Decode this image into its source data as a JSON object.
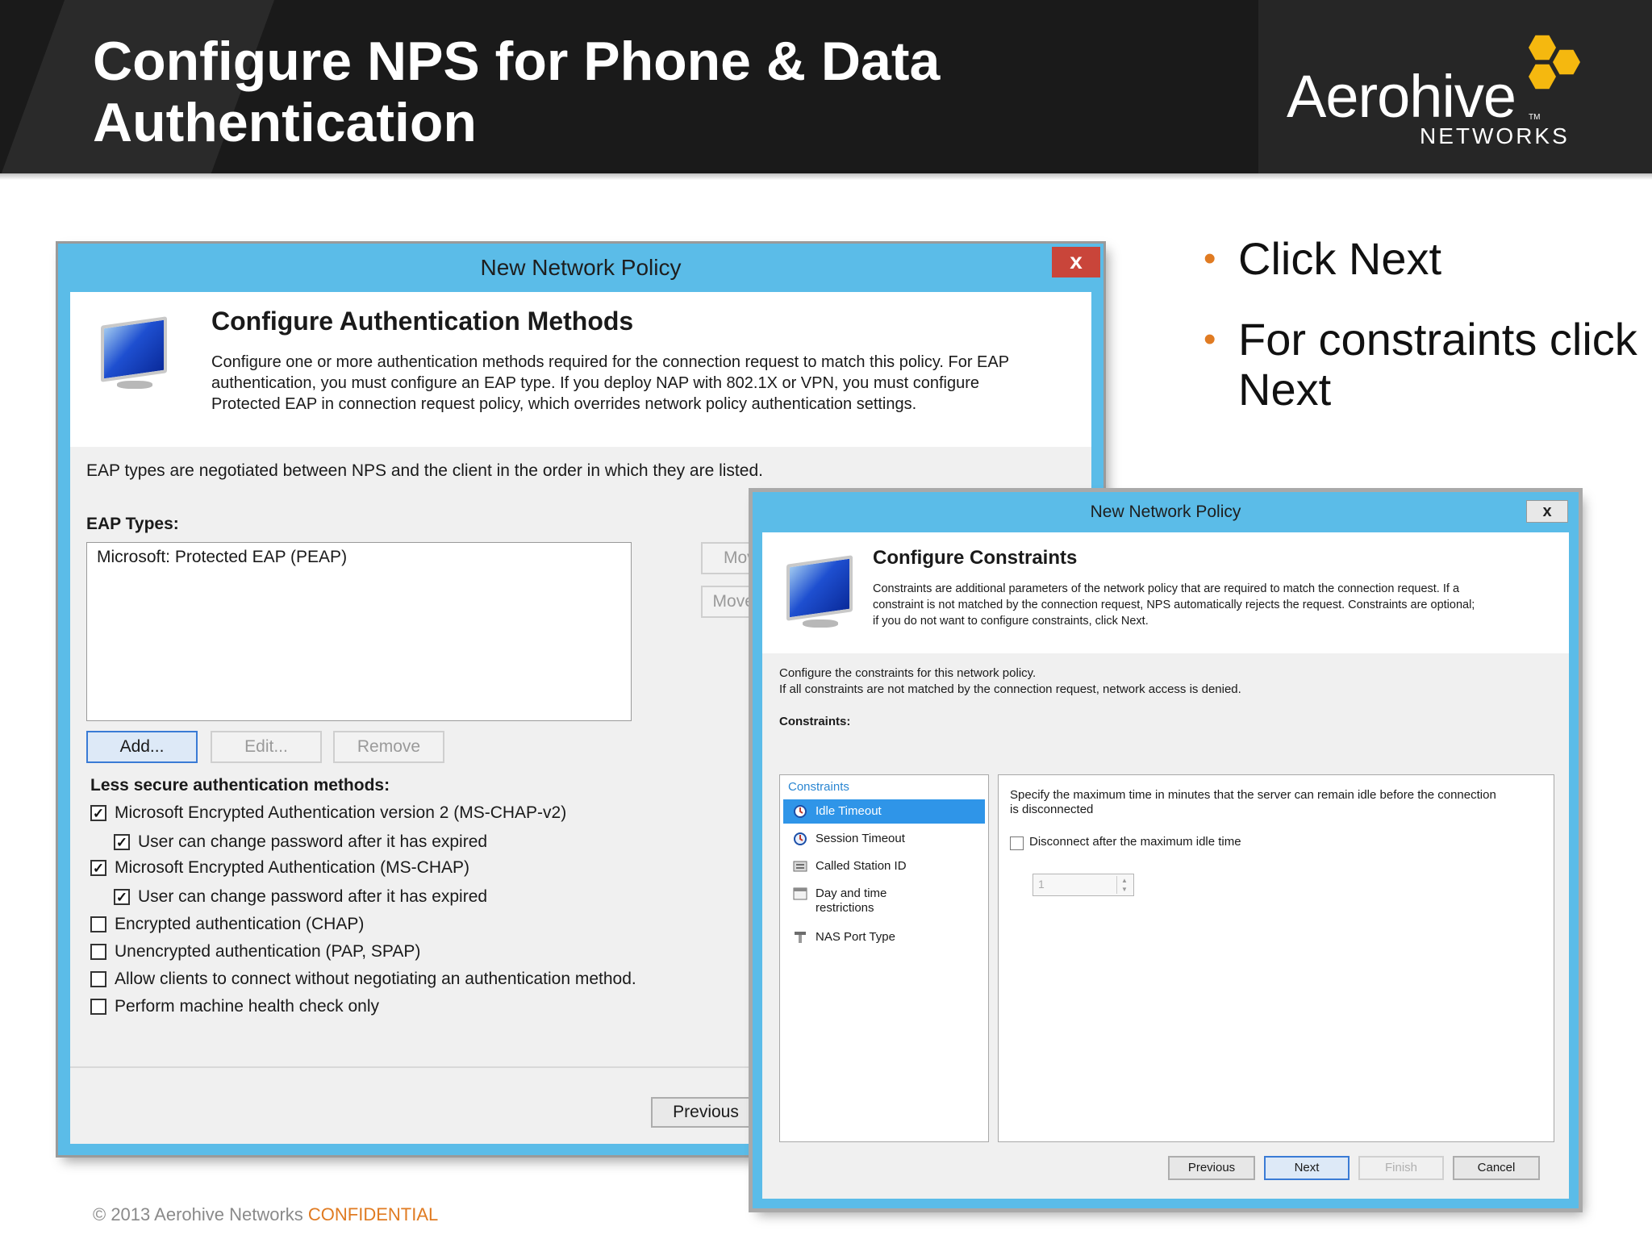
{
  "slide": {
    "title_line1": "Configure NPS for Phone & Data",
    "title_line2": "Authentication",
    "logo_word": "Aerohive",
    "logo_tm": "TM",
    "logo_sub": "NETWORKS",
    "bullets": [
      "Click Next",
      "For constraints click Next"
    ],
    "bullet_glyph": "•",
    "footer_copyright": "© 2013 Aerohive Networks ",
    "footer_confidential": "CONFIDENTIAL",
    "colors": {
      "header_bg": "#1a1a1a",
      "accent_orange": "#e07b22",
      "logo_yellow": "#f5b80f",
      "window_frame": "#5bbce8"
    }
  },
  "dialog1": {
    "title": "New Network Policy",
    "close_glyph": "x",
    "heading": "Configure Authentication Methods",
    "description": [
      "Configure one or more authentication methods required for the connection request to match this policy. For EAP",
      "authentication, you must configure an EAP type. If you deploy NAP with 802.1X or VPN, you must configure",
      "Protected EAP in connection request policy, which overrides network policy authentication settings."
    ],
    "eap_note": "EAP types are negotiated between NPS and the client in the order in which they are listed.",
    "eap_types_label": "EAP Types:",
    "eap_list": [
      "Microsoft: Protected EAP (PEAP)"
    ],
    "move_up_label": "Move Up",
    "move_down_label": "Move Down",
    "add_label": "Add...",
    "edit_label": "Edit...",
    "remove_label": "Remove",
    "less_secure_label": "Less secure authentication methods:",
    "methods": [
      {
        "label": "Microsoft Encrypted Authentication version 2 (MS-CHAP-v2)",
        "checked": true
      },
      {
        "label": "User can change password after it has expired",
        "checked": true
      },
      {
        "label": "Microsoft Encrypted Authentication (MS-CHAP)",
        "checked": true
      },
      {
        "label": "User can change password after it has expired",
        "checked": true
      },
      {
        "label": "Encrypted authentication (CHAP)",
        "checked": false
      },
      {
        "label": "Unencrypted authentication (PAP, SPAP)",
        "checked": false
      },
      {
        "label": "Allow clients to connect without negotiating an authentication method.",
        "checked": false
      },
      {
        "label": "Perform machine health check only",
        "checked": false
      }
    ],
    "check_glyph": "✓",
    "previous_label": "Previous"
  },
  "dialog2": {
    "title": "New Network Policy",
    "close_glyph": "x",
    "heading": "Configure Constraints",
    "description": [
      "Constraints are additional parameters of the network policy that are required to match the connection request. If a",
      "constraint is not matched by the connection request, NPS automatically rejects the request. Constraints are optional;",
      "if you do not want to configure constraints, click Next."
    ],
    "intro_line1": "Configure the constraints for this network policy.",
    "intro_line2": "If all constraints are not matched by the connection request, network access is denied.",
    "constraints_label": "Constraints:",
    "tree_root": "Constraints",
    "tree_items": [
      {
        "label": "Idle Timeout",
        "selected": true,
        "icon": "idle-timeout-icon"
      },
      {
        "label": "Session Timeout",
        "selected": false,
        "icon": "session-timeout-icon"
      },
      {
        "label": "Called Station ID",
        "selected": false,
        "icon": "called-station-icon"
      },
      {
        "label": "Day and time restrictions",
        "selected": false,
        "icon": "calendar-icon"
      },
      {
        "label": "NAS Port Type",
        "selected": false,
        "icon": "nas-port-icon"
      }
    ],
    "panel_desc_line1": "Specify the maximum time in minutes that the server can remain idle before the connection",
    "panel_desc_line2": "is disconnected",
    "disconnect_label": "Disconnect after the maximum idle time",
    "disconnect_checked": false,
    "spin_value": "1",
    "spin_up": "▲",
    "spin_down": "▼",
    "buttons": {
      "previous": "Previous",
      "next": "Next",
      "finish": "Finish",
      "cancel": "Cancel"
    }
  }
}
